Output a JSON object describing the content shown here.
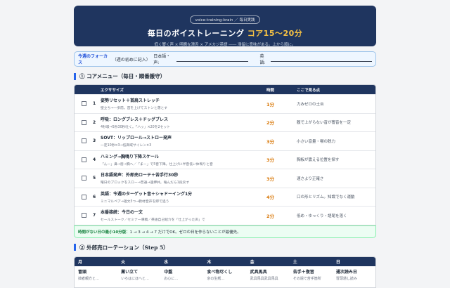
{
  "hero": {
    "pill": "voice-training-brain ／ 毎日実践",
    "title_main": "毎日のボイストレーニング ",
    "title_accent": "コア15〜20分",
    "subtitle": "低く響く声 × 明瞭な滑舌 × アメカジ英語 ―― 滞留に意味がある。上から順に。"
  },
  "focus": {
    "label": "今週のフォーカス",
    "hint": "（週の初めに記入）",
    "jp_label": "日本語・声:",
    "en_label": "英語:"
  },
  "section1": {
    "title": "① コアメニュー（毎日・順番厳守）"
  },
  "table": {
    "headers": {
      "exercise": "エクササイズ",
      "time": "時間",
      "note": "ここで見る点"
    },
    "rows": [
      {
        "num": "1",
        "title": "姿勢リセット＋首肩ストレッチ",
        "sub": "壁立ち→一歩前。首を上げてストンと落とす",
        "time": "1分",
        "note": "力みゼロの土台"
      },
      {
        "num": "2",
        "title": "呼吸：ロングブレス＋ドッグブレス",
        "sub": "4秒吸→5秒30秒吐く。「ハッ」×20を2セット",
        "time": "2分",
        "note": "腹で上がらない音が響音を一定"
      },
      {
        "num": "3",
        "title": "SOVT：リップロール→ストロー発声",
        "sub": "一定10秒×3→低高域サイレン×3",
        "time": "3分",
        "note": "小さい音量・喉の脱力"
      },
      {
        "num": "4",
        "title": "ハミング→胸鳴り下降スケール",
        "sub": "「んー」鼻→唇→胸へ／「まー」で5音下降。仕上げに半音低い体鳴りと音",
        "time": "3分",
        "note": "胸板が震える位置を探す"
      },
      {
        "num": "5",
        "title": "日本語発声：外郎売ローテ＋苦手行30秒",
        "sub": "曜日のブロックをスロー→普通→速押井。噛んだら1段戻す",
        "time": "3分",
        "note": "速さより正確さ"
      },
      {
        "num": "6",
        "title": "英語：今週のターゲット音＋シャドーイング1分",
        "sub": "ミニマルペア→短文3つ→教材音声を即で追う",
        "time": "4分",
        "note": "口の形とリズム。知識でなく運動"
      },
      {
        "num": "7",
        "title": "本番接続：今日の一文",
        "sub": "セールストーク／セミナー導稿／英語自己紹介を「仕上がった声」で",
        "time": "2分",
        "note": "低め・ゆっくり・語尾を落く"
      }
    ]
  },
  "tip": {
    "label": "時間がない日の最小10分版：",
    "text": "1 → 3 → 4 → 7 だけでOK。ゼロの日を作らないことが最優先。"
  },
  "section2": {
    "title": "② 外郎売ローテーション（Step 5）"
  },
  "rotation": {
    "days": [
      "月",
      "火",
      "水",
      "木",
      "金",
      "土",
      "日"
    ],
    "items": [
      {
        "t": "冒頭",
        "s": "拙者親方と…"
      },
      {
        "t": "薬い立て",
        "s": "いろはにほへと…"
      },
      {
        "t": "中盤",
        "s": "お心に…"
      },
      {
        "t": "食べ物尽くし",
        "s": "京の生鱈…"
      },
      {
        "t": "武具馬具",
        "s": "武具馬具武具馬具"
      },
      {
        "t": "苦手＋復習",
        "s": "その週で苦手箇所"
      },
      {
        "t": "通次読み日",
        "s": "冒頭通し読み"
      }
    ]
  }
}
